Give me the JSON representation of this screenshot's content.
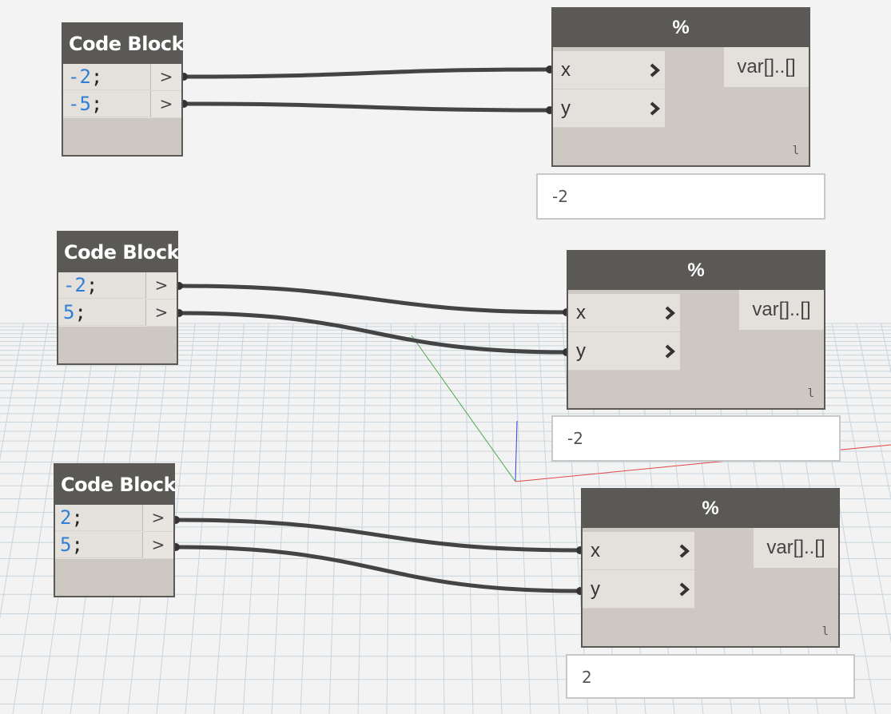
{
  "code_blocks": [
    {
      "title": "Code Block",
      "lines": [
        {
          "num": "-2",
          "punct": ";"
        },
        {
          "num": "-5",
          "punct": ";"
        }
      ],
      "port_symbol": ">"
    },
    {
      "title": "Code Block",
      "lines": [
        {
          "num": "-2",
          "punct": ";"
        },
        {
          "num": "5",
          "punct": ";"
        }
      ],
      "port_symbol": ">"
    },
    {
      "title": "Code Block",
      "lines": [
        {
          "num": "2",
          "punct": ";"
        },
        {
          "num": "5",
          "punct": ";"
        }
      ],
      "port_symbol": ">"
    }
  ],
  "mod_nodes": [
    {
      "title": "%",
      "inputs": [
        "x",
        "y"
      ],
      "output": "var[]..[]",
      "lacing": "l",
      "preview": "-2"
    },
    {
      "title": "%",
      "inputs": [
        "x",
        "y"
      ],
      "output": "var[]..[]",
      "lacing": "l",
      "preview": "-2"
    },
    {
      "title": "%",
      "inputs": [
        "x",
        "y"
      ],
      "output": "var[]..[]",
      "lacing": "l",
      "preview": "2"
    }
  ],
  "colors": {
    "node_header": "#5b5956",
    "node_body": "#cdc8c2",
    "number_literal": "#2f7fd6",
    "wire": "#444444",
    "grid": "#c9d4dc"
  }
}
